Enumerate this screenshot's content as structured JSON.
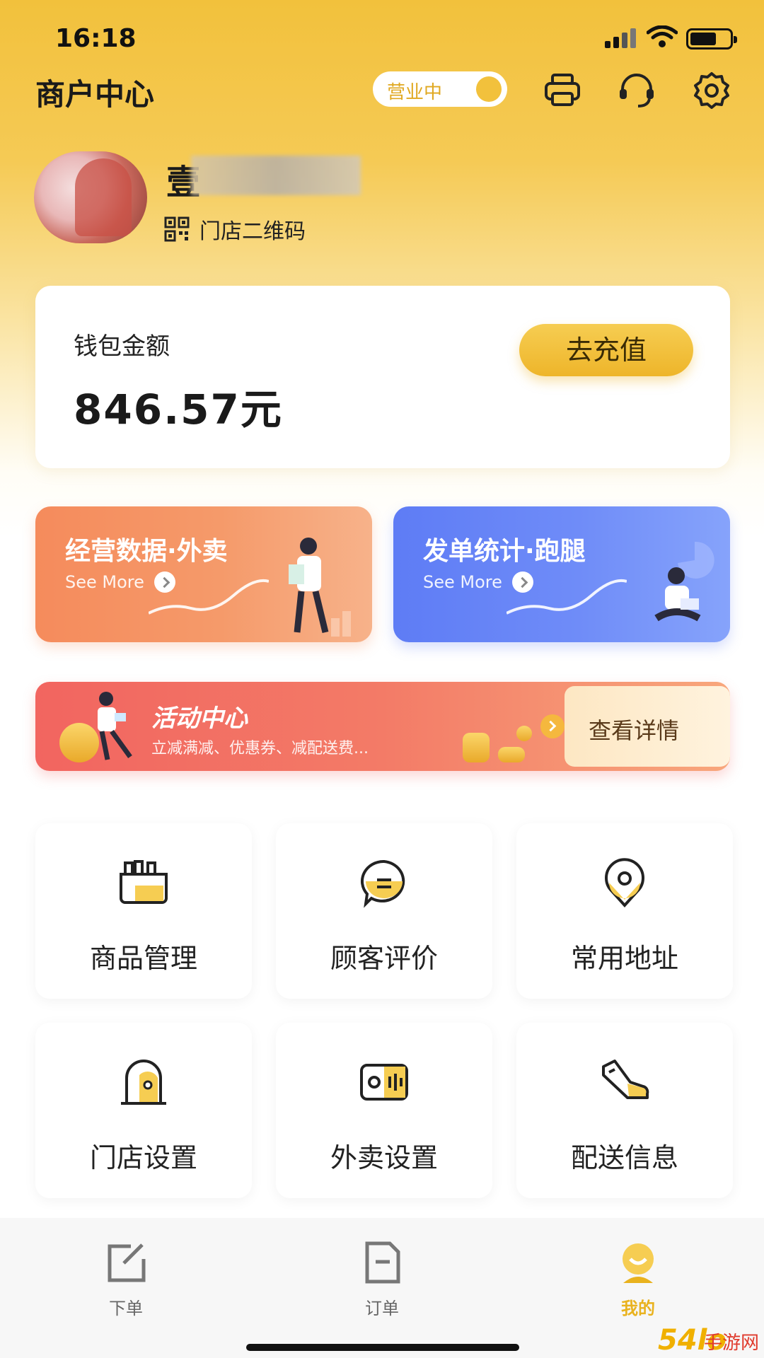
{
  "status_bar": {
    "time": "16:18"
  },
  "header": {
    "title": "商户中心",
    "business_status": "营业中"
  },
  "profile": {
    "store_name_visible": "壹",
    "qr_label": "门店二维码"
  },
  "wallet": {
    "label": "钱包金额",
    "amount": "846.57元",
    "recharge_label": "去充值"
  },
  "stats": [
    {
      "title": "经营数据·外卖",
      "more": "See More"
    },
    {
      "title": "发单统计·跑腿",
      "more": "See More"
    }
  ],
  "activity": {
    "title": "活动中心",
    "subtitle": "立减满减、优惠券、减配送费...",
    "action": "查看详情"
  },
  "grid": [
    {
      "label": "商品管理",
      "icon": "product-icon"
    },
    {
      "label": "顾客评价",
      "icon": "comment-icon"
    },
    {
      "label": "常用地址",
      "icon": "location-icon"
    },
    {
      "label": "门店设置",
      "icon": "store-icon"
    },
    {
      "label": "外卖设置",
      "icon": "takeout-icon"
    },
    {
      "label": "配送信息",
      "icon": "delivery-icon"
    }
  ],
  "bottom_nav": [
    {
      "label": "下单",
      "icon": "edit-icon",
      "active": false
    },
    {
      "label": "订单",
      "icon": "order-icon",
      "active": false
    },
    {
      "label": "我的",
      "icon": "profile-icon",
      "active": true
    }
  ],
  "watermark": {
    "text": "54lo",
    "sub": "手游网"
  },
  "colors": {
    "accent": "#f2c13c",
    "orange_card": "#f58b5c",
    "blue_card": "#5e7cf5",
    "activity": "#f26560",
    "active_tab": "#e9b21e"
  }
}
